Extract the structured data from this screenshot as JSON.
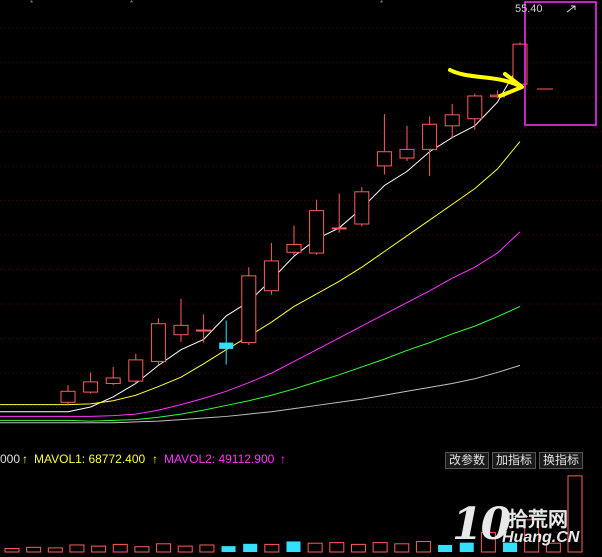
{
  "price_label": "55.40",
  "indicator_bar": {
    "left_value": "000",
    "mavol1_label": "MAVOL1: 68772.400",
    "mavol2_label": "MAVOL2: 49112.900",
    "arrow": "↑",
    "buttons": [
      "改参数",
      "加指标",
      "换指标"
    ]
  },
  "watermark": {
    "mark": "10",
    "cn": "拾荒网",
    "en": "Huang.CN"
  },
  "colors": {
    "up": "#ff5c5c",
    "down": "#33e0ff",
    "ma5": "#ffffff",
    "ma10": "#ffff33",
    "ma20": "#ff33ff",
    "ma30": "#33ff33",
    "ma60": "#c0c0c0",
    "highlight": "#ff33ff",
    "annotation": "#ffff00"
  },
  "chart_data": {
    "type": "candlestick",
    "candles": [
      {
        "o": 9.8,
        "c": 11.2,
        "h": 12.0,
        "l": 9.5
      },
      {
        "o": 11.1,
        "c": 12.4,
        "h": 13.6,
        "l": 10.9
      },
      {
        "o": 12.2,
        "c": 12.9,
        "h": 14.3,
        "l": 12.0
      },
      {
        "o": 12.5,
        "c": 15.2,
        "h": 16.0,
        "l": 12.2
      },
      {
        "o": 15.0,
        "c": 19.8,
        "h": 20.5,
        "l": 14.6
      },
      {
        "o": 18.4,
        "c": 19.6,
        "h": 23.0,
        "l": 17.5
      },
      {
        "o": 19.0,
        "c": 19.0,
        "h": 21.0,
        "l": 17.4
      },
      {
        "o": 17.4,
        "c": 16.6,
        "h": 20.2,
        "l": 14.6
      },
      {
        "o": 17.4,
        "c": 25.9,
        "h": 27.0,
        "l": 17.1
      },
      {
        "o": 24.0,
        "c": 27.8,
        "h": 30.1,
        "l": 23.5
      },
      {
        "o": 28.9,
        "c": 29.9,
        "h": 32.3,
        "l": 28.5
      },
      {
        "o": 28.8,
        "c": 34.2,
        "h": 35.6,
        "l": 28.6
      },
      {
        "o": 32.0,
        "c": 32.0,
        "h": 36.4,
        "l": 31.4
      },
      {
        "o": 32.5,
        "c": 36.6,
        "h": 37.2,
        "l": 32.2
      },
      {
        "o": 39.9,
        "c": 41.7,
        "h": 46.5,
        "l": 38.8
      },
      {
        "o": 40.9,
        "c": 42.0,
        "h": 45.0,
        "l": 40.5
      },
      {
        "o": 42.0,
        "c": 45.2,
        "h": 46.2,
        "l": 38.6
      },
      {
        "o": 45.0,
        "c": 46.4,
        "h": 47.8,
        "l": 43.5
      },
      {
        "o": 45.9,
        "c": 48.8,
        "h": 49.1,
        "l": 44.5
      },
      {
        "o": 48.7,
        "c": 48.9,
        "h": 49.5,
        "l": 48.5
      },
      {
        "o": 50.3,
        "c": 55.4,
        "h": 55.6,
        "l": 50.0
      }
    ],
    "moving_averages": [
      {
        "name": "MA5",
        "values": [
          8.6,
          9.2,
          10.5,
          12.2,
          14.5,
          16.5,
          17.8,
          20.8,
          22.6,
          25.4,
          28.4,
          30.6,
          32.0,
          34.5,
          37.4,
          39.2,
          41.7,
          43.5,
          45.0,
          48.0,
          53.0
        ]
      },
      {
        "name": "MA10",
        "values": [
          9.5,
          9.6,
          10.0,
          10.7,
          11.8,
          13.0,
          14.7,
          16.5,
          18.2,
          20.0,
          22.0,
          23.6,
          25.2,
          27.0,
          29.0,
          31.0,
          33.0,
          35.0,
          37.0,
          39.5,
          43.0
        ]
      },
      {
        "name": "MA20",
        "values": [
          8.0,
          8.0,
          8.1,
          8.3,
          8.8,
          9.5,
          10.3,
          11.2,
          12.3,
          13.5,
          15.0,
          16.5,
          18.0,
          19.5,
          21.0,
          22.5,
          24.0,
          25.6,
          27.0,
          28.8,
          31.5
        ]
      },
      {
        "name": "MA30",
        "values": [
          7.5,
          7.4,
          7.5,
          7.6,
          7.9,
          8.3,
          8.8,
          9.4,
          10.0,
          10.7,
          11.5,
          12.4,
          13.3,
          14.3,
          15.3,
          16.4,
          17.4,
          18.5,
          19.5,
          20.7,
          22.0
        ]
      },
      {
        "name": "MA60",
        "values": [
          7.2,
          7.2,
          7.2,
          7.3,
          7.4,
          7.6,
          7.8,
          8.0,
          8.3,
          8.6,
          9.0,
          9.4,
          9.8,
          10.2,
          10.7,
          11.2,
          11.7,
          12.2,
          12.8,
          13.6,
          14.5
        ]
      }
    ],
    "current_price": 55.4,
    "ylim": [
      5,
      60
    ],
    "volume": {
      "values": [
        0.6,
        0.8,
        0.7,
        1.2,
        1.0,
        1.3,
        0.9,
        1.4,
        1.0,
        1.2,
        1.0,
        1.4,
        1.3,
        1.8,
        1.5,
        1.6,
        1.3,
        1.6,
        1.4,
        1.8,
        1.2,
        1.6,
        3.3,
        1.6,
        5.5,
        1.5,
        13.0
      ],
      "direction": [
        "up",
        "up",
        "up",
        "up",
        "up",
        "up",
        "up",
        "up",
        "up",
        "up",
        "down",
        "down",
        "up",
        "down",
        "up",
        "up",
        "up",
        "up",
        "up",
        "up",
        "down",
        "down",
        "up",
        "down",
        "up",
        "up",
        "up"
      ],
      "ylim": [
        0,
        14
      ]
    },
    "grid": true
  }
}
